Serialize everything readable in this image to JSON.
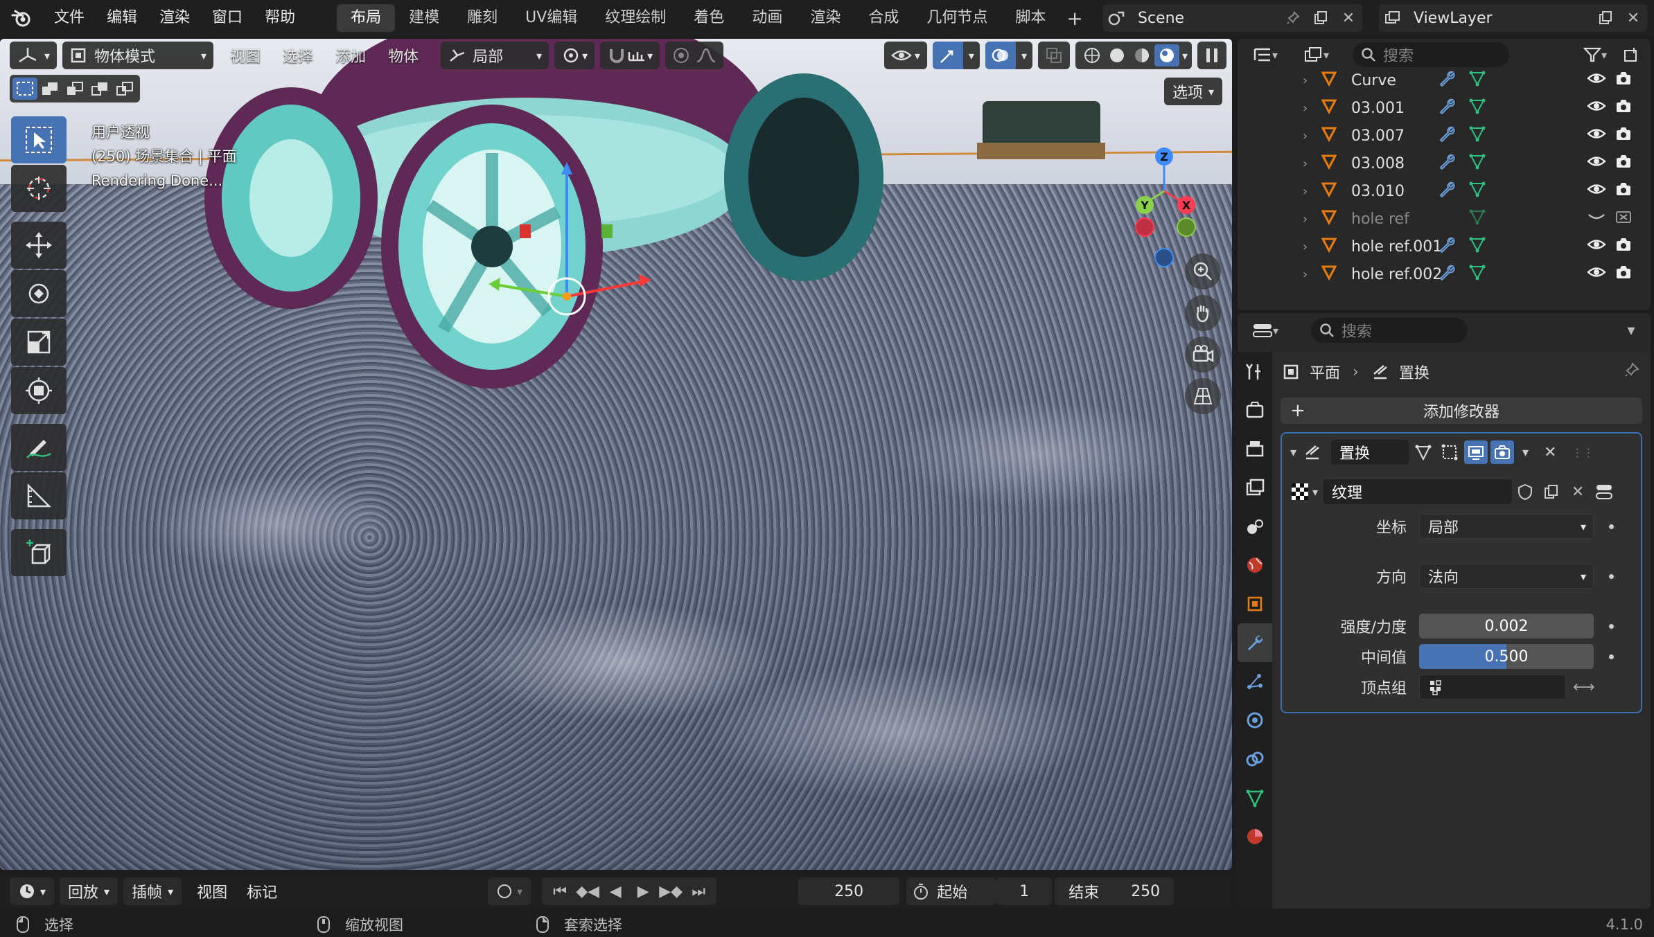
{
  "menu": {
    "items": [
      "文件",
      "编辑",
      "渲染",
      "窗口",
      "帮助"
    ],
    "workspaces": [
      "布局",
      "建模",
      "雕刻",
      "UV编辑",
      "纹理绘制",
      "着色",
      "动画",
      "渲染",
      "合成",
      "几何节点",
      "脚本"
    ],
    "active_workspace": "布局"
  },
  "scene": {
    "name": "Scene"
  },
  "view_layer": {
    "name": "ViewLayer"
  },
  "viewport": {
    "mode": "物体模式",
    "menus": [
      "视图",
      "选择",
      "添加",
      "物体"
    ],
    "orientation": "局部",
    "options_label": "选项",
    "overlay_lines": [
      "用户透视",
      "(250) 场景集合 | 平面",
      "Rendering Done..."
    ]
  },
  "timeline": {
    "playback": "回放",
    "keying": "插帧",
    "view": "视图",
    "marker": "标记",
    "current_frame": "250",
    "start_label": "起始",
    "start": "1",
    "end_label": "结束",
    "end": "250"
  },
  "statusbar": {
    "select": "选择",
    "zoom": "缩放视图",
    "lasso": "套索选择",
    "version": "4.1.0"
  },
  "outliner": {
    "search_placeholder": "搜索",
    "rows": [
      {
        "name": "Curve",
        "dim": false
      },
      {
        "name": "03.001",
        "dim": false
      },
      {
        "name": "03.007",
        "dim": false
      },
      {
        "name": "03.008",
        "dim": false
      },
      {
        "name": "03.010",
        "dim": false
      },
      {
        "name": "hole ref",
        "dim": true
      },
      {
        "name": "hole ref.001",
        "dim": false
      },
      {
        "name": "hole ref.002",
        "dim": false
      }
    ]
  },
  "properties": {
    "search_placeholder": "搜索",
    "breadcrumb_object": "平面",
    "breadcrumb_modifier": "置换",
    "add_modifier": "添加修改器",
    "modifier": {
      "name": "置换",
      "texture_label": "纹理",
      "coords_label": "坐标",
      "coords_value": "局部",
      "direction_label": "方向",
      "direction_value": "法向",
      "strength_label": "强度/力度",
      "strength_value": "0.002",
      "midlevel_label": "中间值",
      "midlevel_value": "0.500",
      "midlevel_fraction": 0.5,
      "vgroup_label": "顶点组"
    }
  },
  "colors": {
    "accent": "#4772b3",
    "panel": "#282828",
    "object_orange": "#e87d0d",
    "mesh_green": "#2ec27e",
    "modifier_blue": "#6a9fdc"
  }
}
